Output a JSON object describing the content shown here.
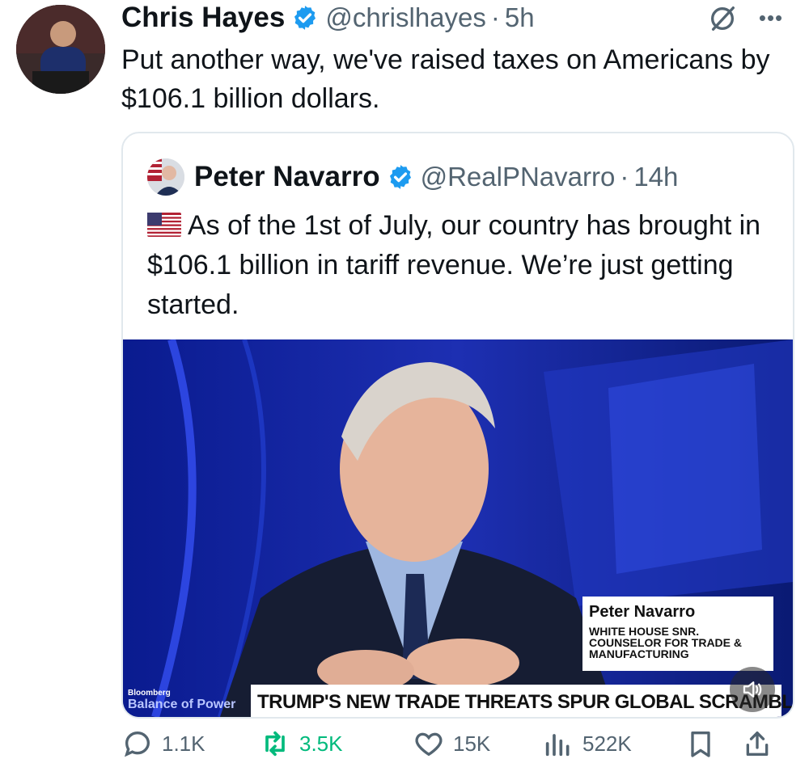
{
  "tweet": {
    "author": {
      "name": "Chris Hayes",
      "handle": "@chrislhayes",
      "time": "5h"
    },
    "text": "Put another way, we've raised taxes on Americans by $106.1 billion dollars.",
    "quote": {
      "author": {
        "name": "Peter Navarro",
        "handle": "@RealPNavarro",
        "time": "14h"
      },
      "text": "As of the 1st of July, our country has brought in $106.1 billion in tariff revenue. We’re just getting started.",
      "media": {
        "lower_third_name": "Peter Navarro",
        "lower_third_role": "WHITE HOUSE SNR. COUNSELOR FOR TRADE & MANUFACTURING",
        "ticker": "TRUMP'S NEW TRADE THREATS SPUR GLOBAL SCRAMBLE",
        "brand_top": "Bloomberg",
        "brand_bottom": "Balance of Power"
      }
    },
    "metrics": {
      "replies": "1.1K",
      "retweets": "3.5K",
      "likes": "15K",
      "views": "522K"
    }
  },
  "colors": {
    "verified": "#1d9bf0",
    "retweet": "#00ba7c",
    "muted": "#536471"
  }
}
